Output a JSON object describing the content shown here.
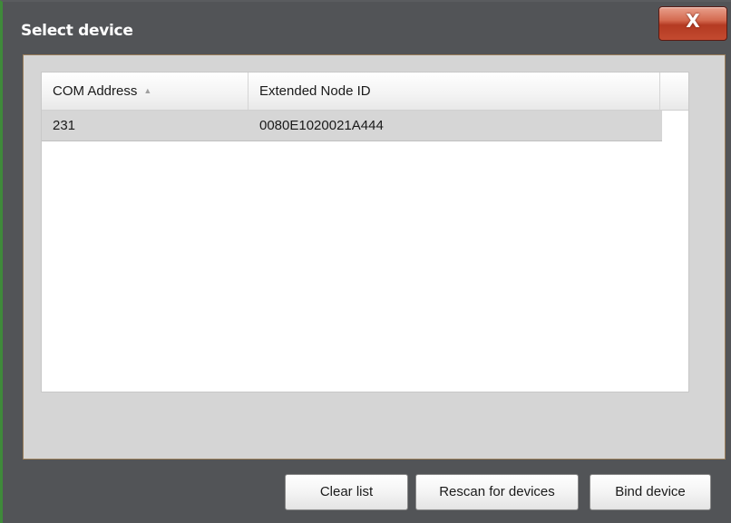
{
  "window": {
    "title": "Select device",
    "close_label": "X"
  },
  "table": {
    "columns": [
      {
        "label": "COM Address",
        "sorted": "ascending"
      },
      {
        "label": "Extended Node ID"
      }
    ],
    "rows": [
      {
        "com_address": "231",
        "extended_node_id": "0080E1020021A444",
        "selected": true
      }
    ]
  },
  "buttons": {
    "clear_list": "Clear list",
    "rescan": "Rescan for devices",
    "bind": "Bind device"
  },
  "icons": {
    "close": "close-icon",
    "sort": "sort-ascending-icon"
  },
  "colors": {
    "window_background": "#525457",
    "close_button": "#c34a30",
    "selected_row": "#d6d6d6"
  }
}
